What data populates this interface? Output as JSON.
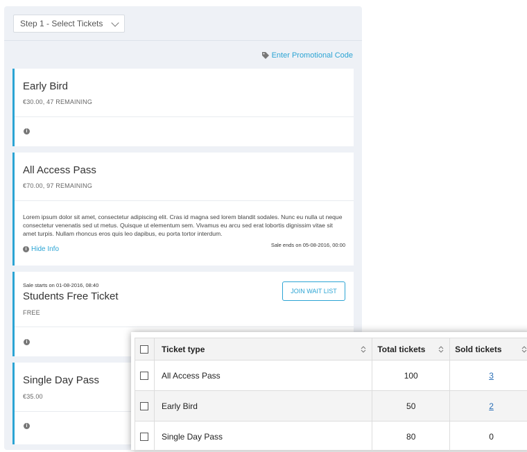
{
  "header": {
    "step_select": "Step 1 - Select Tickets",
    "promo_link": "Enter Promotional Code"
  },
  "tickets": [
    {
      "name": "Early Bird",
      "sub": "€30.00, 47 REMAINING"
    },
    {
      "name": "All Access Pass",
      "sub": "€70.00, 97 REMAINING",
      "description": "Lorem ipsum dolor sit amet, consectetur adipiscing elit. Cras id magna sed lorem blandit sodales. Nunc eu nulla ut neque consectetur venenatis sed ut metus. Quisque ut elementum sem. Vivamus eu arcu sed erat lobortis dignissim vitae sit amet turpis. Nullam rhoncus eros quis leo dapibus, eu porta tortor interdum.",
      "hide_info": "Hide Info",
      "sale_ends": "Sale ends on 05-08-2016, 00:00"
    },
    {
      "name": "Students Free Ticket",
      "sub": "FREE",
      "sale_starts": "Sale starts on 01-08-2016, 08:40",
      "wait_button": "JOIN WAIT LIST"
    },
    {
      "name": "Single Day Pass",
      "sub": "€35.00"
    }
  ],
  "table": {
    "headers": [
      "Ticket type",
      "Total tickets",
      "Sold tickets"
    ],
    "rows": [
      {
        "type": "All Access Pass",
        "total": "100",
        "sold": "3",
        "sold_link": true
      },
      {
        "type": "Early Bird",
        "total": "50",
        "sold": "2",
        "sold_link": true
      },
      {
        "type": "Single Day Pass",
        "total": "80",
        "sold": "0",
        "sold_link": false
      }
    ]
  },
  "colors": {
    "accent": "#2ba4d4",
    "panel_bg": "#eef1f6"
  },
  "icons": {
    "promo": "tag-icon",
    "info": "info-icon",
    "select": "chevron-down-icon",
    "sort": "sort-icon"
  }
}
